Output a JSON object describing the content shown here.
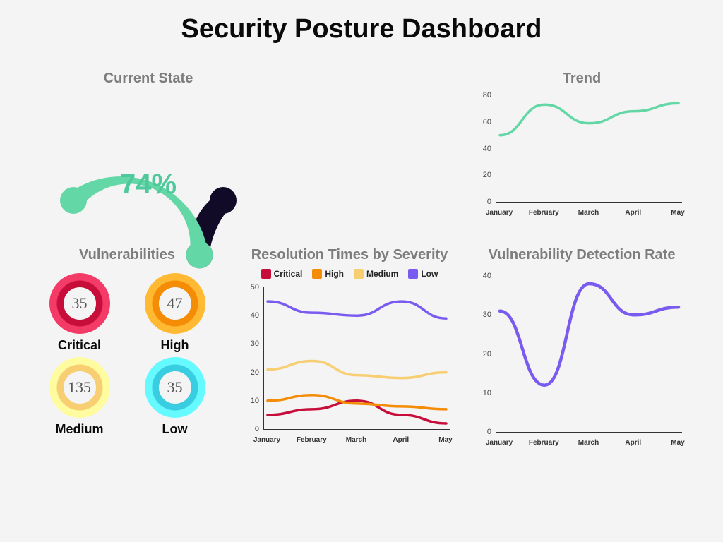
{
  "title": "Security Posture Dashboard",
  "colors": {
    "green": "#63d7a6",
    "dark": "#120b28",
    "critical": "#c70e3a",
    "high": "#f48c06",
    "medium": "#f8ce72",
    "low": "#38cde0",
    "purple": "#7a5bf0"
  },
  "gauge": {
    "title": "Current State",
    "value_pct": 74,
    "value_label": "74%"
  },
  "trend": {
    "title": "Trend"
  },
  "vulnerabilities": {
    "title": "Vulnerabilities",
    "items": [
      {
        "label": "Critical",
        "value": 35,
        "color": "critical"
      },
      {
        "label": "High",
        "value": 47,
        "color": "high"
      },
      {
        "label": "Medium",
        "value": 135,
        "color": "medium"
      },
      {
        "label": "Low",
        "value": 35,
        "color": "low"
      }
    ]
  },
  "resolution": {
    "title": "Resolution Times by Severity",
    "legend": [
      {
        "label": "Critical",
        "color": "critical"
      },
      {
        "label": "High",
        "color": "high"
      },
      {
        "label": "Medium",
        "color": "medium"
      },
      {
        "label": "Low",
        "color": "purple"
      }
    ]
  },
  "detection": {
    "title": "Vulnerability Detection Rate"
  },
  "chart_data": [
    {
      "id": "gauge",
      "type": "gauge",
      "title": "Current State",
      "value": 74,
      "range": [
        0,
        100
      ],
      "unit": "%"
    },
    {
      "id": "trend",
      "type": "line",
      "title": "Trend",
      "x": [
        "January",
        "February",
        "March",
        "April",
        "May"
      ],
      "values": [
        50,
        73,
        59,
        68,
        74
      ],
      "ylim": [
        0,
        80
      ],
      "yticks": [
        0,
        20,
        40,
        60,
        80
      ]
    },
    {
      "id": "resolution",
      "type": "line",
      "title": "Resolution Times by Severity",
      "categories": [
        "January",
        "February",
        "March",
        "April",
        "May"
      ],
      "series": [
        {
          "name": "Critical",
          "values": [
            5,
            7,
            10,
            5,
            2
          ]
        },
        {
          "name": "High",
          "values": [
            10,
            12,
            9,
            8,
            7
          ]
        },
        {
          "name": "Medium",
          "values": [
            21,
            24,
            19,
            18,
            20
          ]
        },
        {
          "name": "Low",
          "values": [
            45,
            41,
            40,
            45,
            39
          ]
        }
      ],
      "ylim": [
        0,
        50
      ],
      "yticks": [
        0,
        10,
        20,
        30,
        40,
        50
      ]
    },
    {
      "id": "detection",
      "type": "line",
      "title": "Vulnerability Detection Rate",
      "x": [
        "January",
        "February",
        "March",
        "April",
        "May"
      ],
      "values": [
        31,
        12,
        38,
        30,
        32
      ],
      "ylim": [
        0,
        40
      ],
      "yticks": [
        0,
        10,
        20,
        30,
        40
      ]
    }
  ]
}
